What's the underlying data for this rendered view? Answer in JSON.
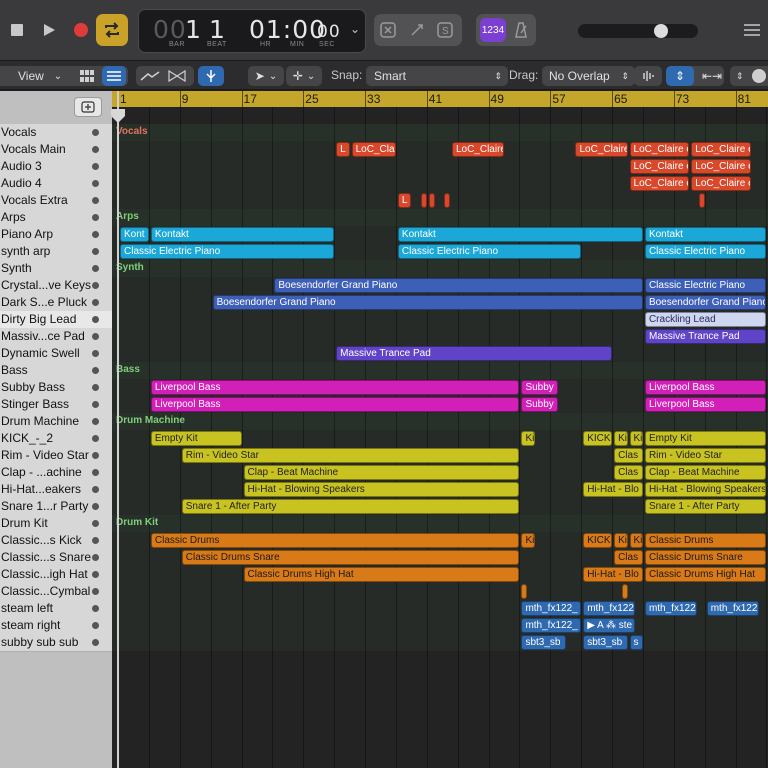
{
  "control_bar": {
    "lcd": {
      "bar": "1",
      "beat": "1",
      "bar_dim": "00",
      "time_main": "01:00",
      "time_frames": "00",
      "labels": [
        "BAR",
        "BEAT",
        "HR",
        "MIN",
        "SEC"
      ]
    },
    "count_in_label": "1234",
    "colors": {
      "record": "#e03b3b",
      "cycle": "#c9a227",
      "count_in": "#7b3fd1"
    }
  },
  "toolbar": {
    "view_label": "View",
    "snap_label": "Snap:",
    "snap_value": "Smart",
    "drag_label": "Drag:",
    "drag_value": "No Overlap"
  },
  "ruler": {
    "bars": [
      "1",
      "9",
      "17",
      "25",
      "33",
      "41",
      "49",
      "57",
      "65",
      "73",
      "81"
    ]
  },
  "tracks": [
    "Vocals",
    "Vocals Main",
    "Audio 3",
    "Audio 4",
    "Vocals Extra",
    "Arps",
    "Piano Arp",
    "synth arp",
    "Synth",
    "Crystal...ve Keys",
    "Dark S...e Pluck",
    "Dirty Big Lead",
    "Massiv...ce Pad",
    "Dynamic Swell",
    "Bass",
    "Subby Bass",
    "Stinger Bass",
    "Drum Machine",
    "KICK_-_2",
    "Rim - Video Star",
    "Clap - ...achine",
    "Hi-Hat...eakers",
    "Snare 1...r Party",
    "Drum Kit",
    "Classic...s Kick",
    "Classic...s Snare",
    "Classic...igh Hat",
    "Classic...Cymbal",
    "steam left",
    "steam right",
    "subby sub sub"
  ],
  "selected_track": "Dirty Big Lead",
  "groups": [
    {
      "row": 0,
      "label": "Vocals",
      "color": "#e2725b"
    },
    {
      "row": 5,
      "label": "Arps",
      "color": "#7fd07a"
    },
    {
      "row": 8,
      "label": "Synth",
      "color": "#7fd07a"
    },
    {
      "row": 14,
      "label": "Bass",
      "color": "#7fd07a"
    },
    {
      "row": 17,
      "label": "Drum Machine",
      "color": "#7fd07a"
    },
    {
      "row": 23,
      "label": "Drum Kit",
      "color": "#7fd07a"
    }
  ],
  "regions": [
    {
      "row": 1,
      "bar": 29,
      "len": 2,
      "label": "L",
      "color": "#d9482b"
    },
    {
      "row": 1,
      "bar": 31,
      "len": 6,
      "label": "LoC_Clai",
      "color": "#d9482b"
    },
    {
      "row": 1,
      "bar": 44,
      "len": 7,
      "label": "LoC_Claire",
      "color": "#d9482b"
    },
    {
      "row": 1,
      "bar": 60,
      "len": 7,
      "label": "LoC_Claire",
      "color": "#d9482b"
    },
    {
      "row": 1,
      "bar": 67,
      "len": 8,
      "label": "LoC_Claire e",
      "color": "#d9482b"
    },
    {
      "row": 1,
      "bar": 75,
      "len": 8,
      "label": "LoC_Claire e",
      "color": "#d9482b"
    },
    {
      "row": 2,
      "bar": 67,
      "len": 8,
      "label": "LoC_Claire e",
      "color": "#d9482b"
    },
    {
      "row": 2,
      "bar": 75,
      "len": 8,
      "label": "LoC_Claire e",
      "color": "#d9482b"
    },
    {
      "row": 3,
      "bar": 67,
      "len": 8,
      "label": "LoC_Claire e",
      "color": "#d9482b"
    },
    {
      "row": 3,
      "bar": 75,
      "len": 8,
      "label": "LoC_Claire e",
      "color": "#d9482b"
    },
    {
      "row": 4,
      "bar": 37,
      "len": 2,
      "label": "L",
      "color": "#d9482b"
    },
    {
      "row": 4,
      "bar": 40,
      "len": 1,
      "label": "",
      "color": "#d9482b"
    },
    {
      "row": 4,
      "bar": 41,
      "len": 1,
      "label": "",
      "color": "#d9482b"
    },
    {
      "row": 4,
      "bar": 43,
      "len": 1,
      "label": "",
      "color": "#d9482b"
    },
    {
      "row": 4,
      "bar": 76,
      "len": 1,
      "label": "",
      "color": "#d9482b"
    },
    {
      "row": 6,
      "bar": 1,
      "len": 4,
      "label": "Kont",
      "color": "#1ba8d8"
    },
    {
      "row": 6,
      "bar": 5,
      "len": 24,
      "label": "Kontakt",
      "color": "#1ba8d8"
    },
    {
      "row": 6,
      "bar": 37,
      "len": 32,
      "label": "Kontakt",
      "color": "#1ba8d8"
    },
    {
      "row": 6,
      "bar": 69,
      "len": 16,
      "label": "Kontakt",
      "color": "#1ba8d8"
    },
    {
      "row": 7,
      "bar": 1,
      "len": 28,
      "label": "Classic Electric Piano",
      "color": "#1ba8d8"
    },
    {
      "row": 7,
      "bar": 37,
      "len": 24,
      "label": "Classic Electric Piano",
      "color": "#1ba8d8"
    },
    {
      "row": 7,
      "bar": 69,
      "len": 16,
      "label": "Classic Electric Piano",
      "color": "#1ba8d8"
    },
    {
      "row": 9,
      "bar": 21,
      "len": 48,
      "label": "Boesendorfer Grand Piano",
      "color": "#3e5fb8"
    },
    {
      "row": 9,
      "bar": 69,
      "len": 16,
      "label": "Classic Electric Piano",
      "color": "#3e5fb8"
    },
    {
      "row": 10,
      "bar": 13,
      "len": 56,
      "label": "Boesendorfer Grand Piano",
      "color": "#3e5fb8"
    },
    {
      "row": 10,
      "bar": 69,
      "len": 16,
      "label": "Boesendorfer Grand Piano",
      "color": "#3e5fb8"
    },
    {
      "row": 11,
      "bar": 69,
      "len": 16,
      "label": "Crackling Lead",
      "color": "#cfd6f0",
      "text": "#2a2a5a"
    },
    {
      "row": 12,
      "bar": 69,
      "len": 16,
      "label": "Massive Trance Pad",
      "color": "#5f44c8"
    },
    {
      "row": 13,
      "bar": 29,
      "len": 36,
      "label": "Massive Trance Pad",
      "color": "#5f44c8"
    },
    {
      "row": 15,
      "bar": 5,
      "len": 48,
      "label": "Liverpool Bass",
      "color": "#d21fb8"
    },
    {
      "row": 15,
      "bar": 53,
      "len": 5,
      "label": "Subby",
      "color": "#d21fb8"
    },
    {
      "row": 15,
      "bar": 69,
      "len": 16,
      "label": "Liverpool Bass",
      "color": "#d21fb8"
    },
    {
      "row": 16,
      "bar": 5,
      "len": 48,
      "label": "Liverpool Bass",
      "color": "#d21fb8"
    },
    {
      "row": 16,
      "bar": 53,
      "len": 5,
      "label": "Subby",
      "color": "#d21fb8"
    },
    {
      "row": 16,
      "bar": 69,
      "len": 16,
      "label": "Liverpool Bass",
      "color": "#d21fb8"
    },
    {
      "row": 18,
      "bar": 5,
      "len": 12,
      "label": "Empty Kit",
      "color": "#c9c322",
      "text": "#222"
    },
    {
      "row": 18,
      "bar": 53,
      "len": 2,
      "label": "Ki",
      "color": "#c9c322",
      "text": "#222"
    },
    {
      "row": 18,
      "bar": 61,
      "len": 4,
      "label": "KICK",
      "color": "#c9c322",
      "text": "#222"
    },
    {
      "row": 18,
      "bar": 65,
      "len": 2,
      "label": "Ki",
      "color": "#c9c322",
      "text": "#222"
    },
    {
      "row": 18,
      "bar": 67,
      "len": 2,
      "label": "Ki",
      "color": "#c9c322",
      "text": "#222"
    },
    {
      "row": 18,
      "bar": 69,
      "len": 16,
      "label": "Empty Kit",
      "color": "#c9c322",
      "text": "#222"
    },
    {
      "row": 19,
      "bar": 9,
      "len": 44,
      "label": "Rim - Video Star",
      "color": "#c9c322",
      "text": "#222"
    },
    {
      "row": 19,
      "bar": 65,
      "len": 4,
      "label": "Clas",
      "color": "#c9c322",
      "text": "#222"
    },
    {
      "row": 19,
      "bar": 69,
      "len": 16,
      "label": "Rim - Video Star",
      "color": "#c9c322",
      "text": "#222"
    },
    {
      "row": 20,
      "bar": 17,
      "len": 36,
      "label": "Clap - Beat Machine",
      "color": "#c9c322",
      "text": "#222"
    },
    {
      "row": 20,
      "bar": 65,
      "len": 4,
      "label": "Clas",
      "color": "#c9c322",
      "text": "#222"
    },
    {
      "row": 20,
      "bar": 69,
      "len": 16,
      "label": "Clap - Beat Machine",
      "color": "#c9c322",
      "text": "#222"
    },
    {
      "row": 21,
      "bar": 17,
      "len": 36,
      "label": "Hi-Hat - Blowing Speakers",
      "color": "#c9c322",
      "text": "#222"
    },
    {
      "row": 21,
      "bar": 61,
      "len": 8,
      "label": "Hi-Hat - Blo",
      "color": "#c9c322",
      "text": "#222"
    },
    {
      "row": 21,
      "bar": 69,
      "len": 16,
      "label": "Hi-Hat - Blowing Speakers",
      "color": "#c9c322",
      "text": "#222"
    },
    {
      "row": 22,
      "bar": 9,
      "len": 44,
      "label": "Snare 1 - After Party",
      "color": "#c9c322",
      "text": "#222"
    },
    {
      "row": 22,
      "bar": 69,
      "len": 16,
      "label": "Snare 1 - After Party",
      "color": "#c9c322",
      "text": "#222"
    },
    {
      "row": 24,
      "bar": 5,
      "len": 48,
      "label": "Classic Drums",
      "color": "#d97a18",
      "text": "#1a1a1a"
    },
    {
      "row": 24,
      "bar": 53,
      "len": 2,
      "label": "Ki",
      "color": "#d97a18",
      "text": "#1a1a1a"
    },
    {
      "row": 24,
      "bar": 61,
      "len": 4,
      "label": "KICK",
      "color": "#d97a18",
      "text": "#1a1a1a"
    },
    {
      "row": 24,
      "bar": 65,
      "len": 2,
      "label": "Ki",
      "color": "#d97a18",
      "text": "#1a1a1a"
    },
    {
      "row": 24,
      "bar": 67,
      "len": 2,
      "label": "Ki",
      "color": "#d97a18",
      "text": "#1a1a1a"
    },
    {
      "row": 24,
      "bar": 69,
      "len": 16,
      "label": "Classic Drums",
      "color": "#d97a18",
      "text": "#1a1a1a"
    },
    {
      "row": 25,
      "bar": 9,
      "len": 44,
      "label": "Classic Drums Snare",
      "color": "#d97a18",
      "text": "#1a1a1a"
    },
    {
      "row": 25,
      "bar": 65,
      "len": 4,
      "label": "Clas",
      "color": "#d97a18",
      "text": "#1a1a1a"
    },
    {
      "row": 25,
      "bar": 69,
      "len": 16,
      "label": "Classic Drums Snare",
      "color": "#d97a18",
      "text": "#1a1a1a"
    },
    {
      "row": 26,
      "bar": 17,
      "len": 36,
      "label": "Classic Drums High Hat",
      "color": "#d97a18",
      "text": "#1a1a1a"
    },
    {
      "row": 26,
      "bar": 61,
      "len": 8,
      "label": "Hi-Hat - Blo",
      "color": "#d97a18",
      "text": "#1a1a1a"
    },
    {
      "row": 26,
      "bar": 69,
      "len": 16,
      "label": "Classic Drums High Hat",
      "color": "#d97a18",
      "text": "#1a1a1a"
    },
    {
      "row": 27,
      "bar": 53,
      "len": 1,
      "label": "",
      "color": "#d97a18"
    },
    {
      "row": 27,
      "bar": 66,
      "len": 1,
      "label": "",
      "color": "#d97a18"
    },
    {
      "row": 28,
      "bar": 53,
      "len": 8,
      "label": "mth_fx122_",
      "color": "#2f6ab0"
    },
    {
      "row": 28,
      "bar": 61,
      "len": 7,
      "label": "mth_fx122",
      "color": "#2f6ab0"
    },
    {
      "row": 28,
      "bar": 69,
      "len": 7,
      "label": "mth_fx122",
      "color": "#2f6ab0"
    },
    {
      "row": 28,
      "bar": 77,
      "len": 7,
      "label": "mth_fx122",
      "color": "#2f6ab0"
    },
    {
      "row": 29,
      "bar": 53,
      "len": 8,
      "label": "mth_fx122_",
      "color": "#2f6ab0"
    },
    {
      "row": 29,
      "bar": 61,
      "len": 7,
      "label": "▶ A ⁂ ste",
      "color": "#2f6ab0"
    },
    {
      "row": 30,
      "bar": 53,
      "len": 6,
      "label": "sbt3_sb",
      "color": "#2f6ab0"
    },
    {
      "row": 30,
      "bar": 61,
      "len": 6,
      "label": "sbt3_sb",
      "color": "#2f6ab0"
    },
    {
      "row": 30,
      "bar": 67,
      "len": 2,
      "label": "s",
      "color": "#2f6ab0"
    }
  ]
}
